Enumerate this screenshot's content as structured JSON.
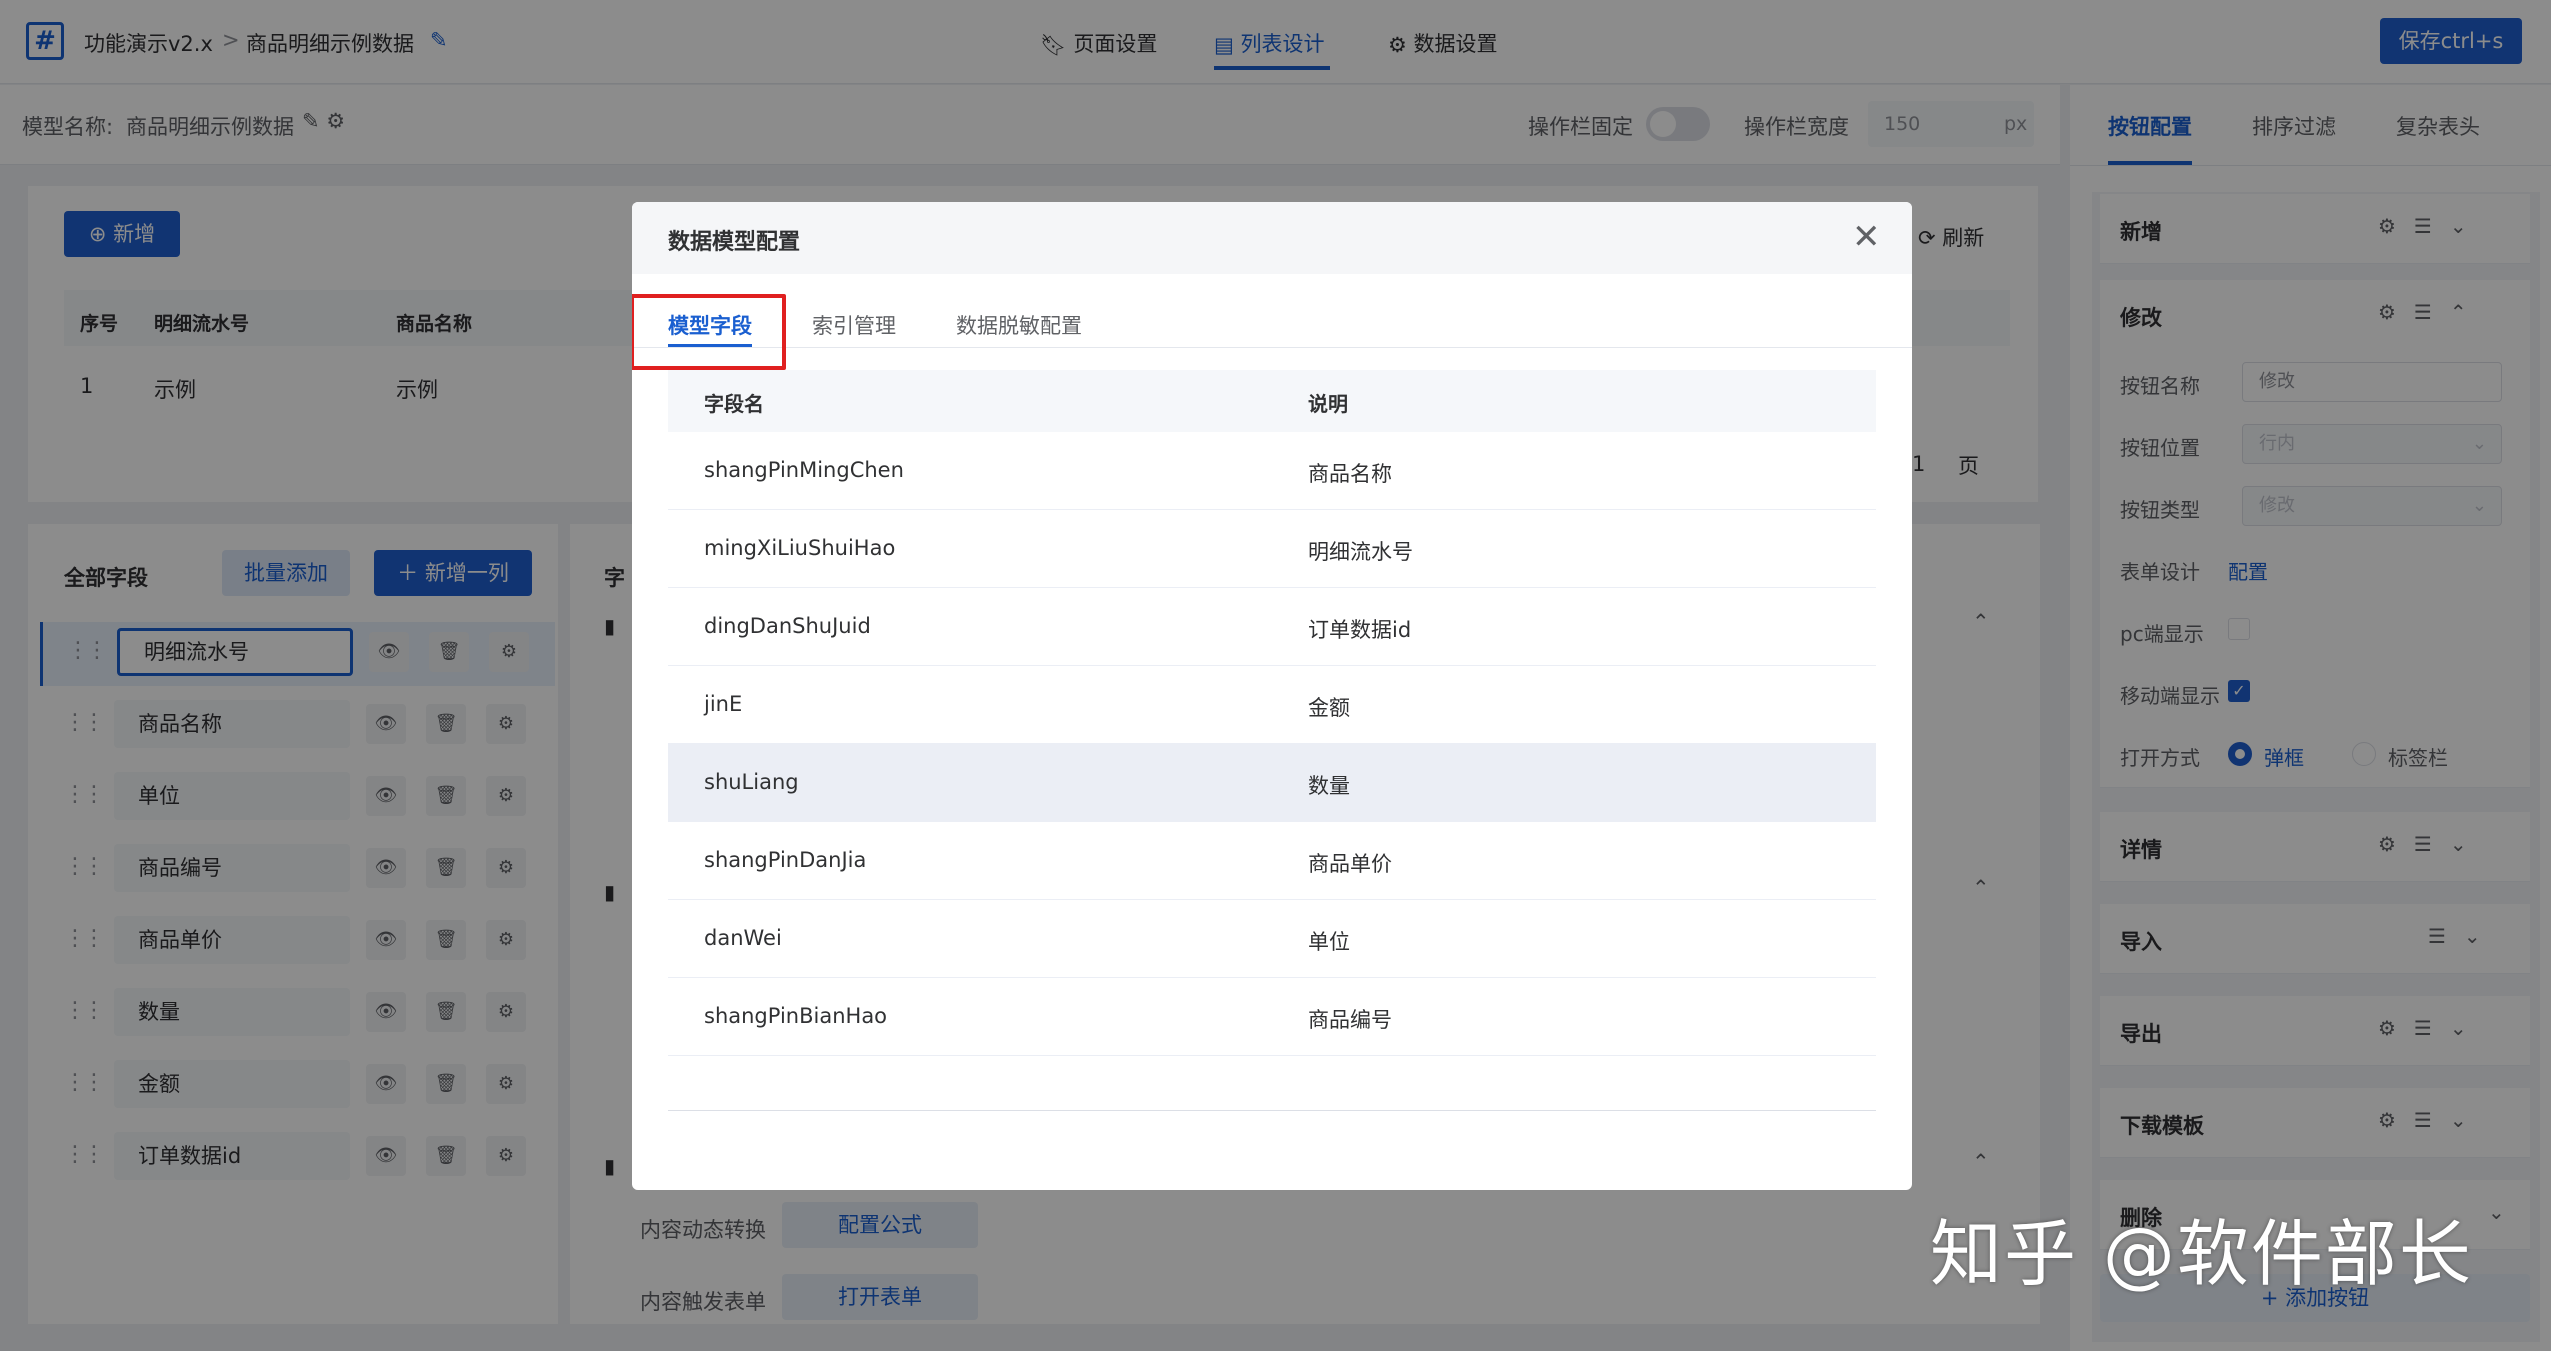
{
  "topbar": {
    "app_name": "功能演示v2.x",
    "separator": ">",
    "page_name": "商品明细示例数据",
    "tabs": [
      {
        "label": "页面设置",
        "icon": "bookmark-icon"
      },
      {
        "label": "列表设计",
        "icon": "document-icon"
      },
      {
        "label": "数据设置",
        "icon": "gear-icon"
      }
    ],
    "save_label": "保存ctrl+s"
  },
  "subbar": {
    "model_label": "模型名称:",
    "model_name": "商品明细示例数据",
    "fixed_label": "操作栏固定",
    "width_label": "操作栏宽度",
    "width_value": "150",
    "width_unit": "px"
  },
  "list": {
    "add_label": "新增",
    "refresh_label": "刷新",
    "columns": [
      "序号",
      "明细流水号",
      "商品名称"
    ],
    "row": [
      "1",
      "示例",
      "示例"
    ],
    "page_value": "1",
    "page_suffix": "页"
  },
  "fields": {
    "title": "全部字段",
    "batch_add": "批量添加",
    "add_column": "新增一列",
    "items": [
      "明细流水号",
      "商品名称",
      "单位",
      "商品编号",
      "商品单价",
      "数量",
      "金额",
      "订单数据id"
    ],
    "center_label": "字",
    "dyn_label": "内容动态转换",
    "dyn_btn": "配置公式",
    "trigger_label": "内容触发表单",
    "trigger_btn": "打开表单"
  },
  "rightpanel": {
    "tabs": [
      "按钮配置",
      "排序过滤",
      "复杂表头"
    ],
    "sections": [
      "新增",
      "修改",
      "详情",
      "导入",
      "导出",
      "下载模板",
      "删除"
    ],
    "edit": {
      "name_label": "按钮名称",
      "name_value": "修改",
      "pos_label": "按钮位置",
      "pos_value": "行内",
      "type_label": "按钮类型",
      "type_value": "修改",
      "form_label": "表单设计",
      "form_link": "配置",
      "pc_label": "pc端显示",
      "mobile_label": "移动端显示",
      "open_label": "打开方式",
      "open_opt1": "弹框",
      "open_opt2": "标签栏"
    },
    "add_button": "+ 添加按钮"
  },
  "modal": {
    "title": "数据模型配置",
    "tabs": [
      "模型字段",
      "索引管理",
      "数据脱敏配置"
    ],
    "headers": [
      "字段名",
      "说明"
    ],
    "rows": [
      [
        "shangPinMingChen",
        "商品名称"
      ],
      [
        "mingXiLiuShuiHao",
        "明细流水号"
      ],
      [
        "dingDanShuJuid",
        "订单数据id"
      ],
      [
        "jinE",
        "金额"
      ],
      [
        "shuLiang",
        "数量"
      ],
      [
        "shangPinDanJia",
        "商品单价"
      ],
      [
        "danWei",
        "单位"
      ],
      [
        "shangPinBianHao",
        "商品编号"
      ]
    ]
  },
  "watermark": "知乎 @软件部长",
  "colors": {
    "accent": "#1f5fcf",
    "highlight_box": "#e02020"
  }
}
